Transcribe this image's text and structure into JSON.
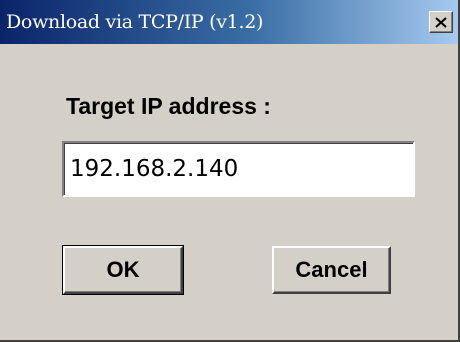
{
  "window": {
    "title": "Download via TCP/IP (v1.2)",
    "close_icon": "close-icon"
  },
  "form": {
    "prompt_label": "Target IP address :",
    "ip_value": "192.168.2.140"
  },
  "buttons": {
    "ok_label": "OK",
    "cancel_label": "Cancel"
  },
  "colors": {
    "dialog_face": "#d4d0c8",
    "titlebar_start": "#0a246a",
    "titlebar_end": "#a6caf0",
    "title_text": "#ffffff"
  }
}
